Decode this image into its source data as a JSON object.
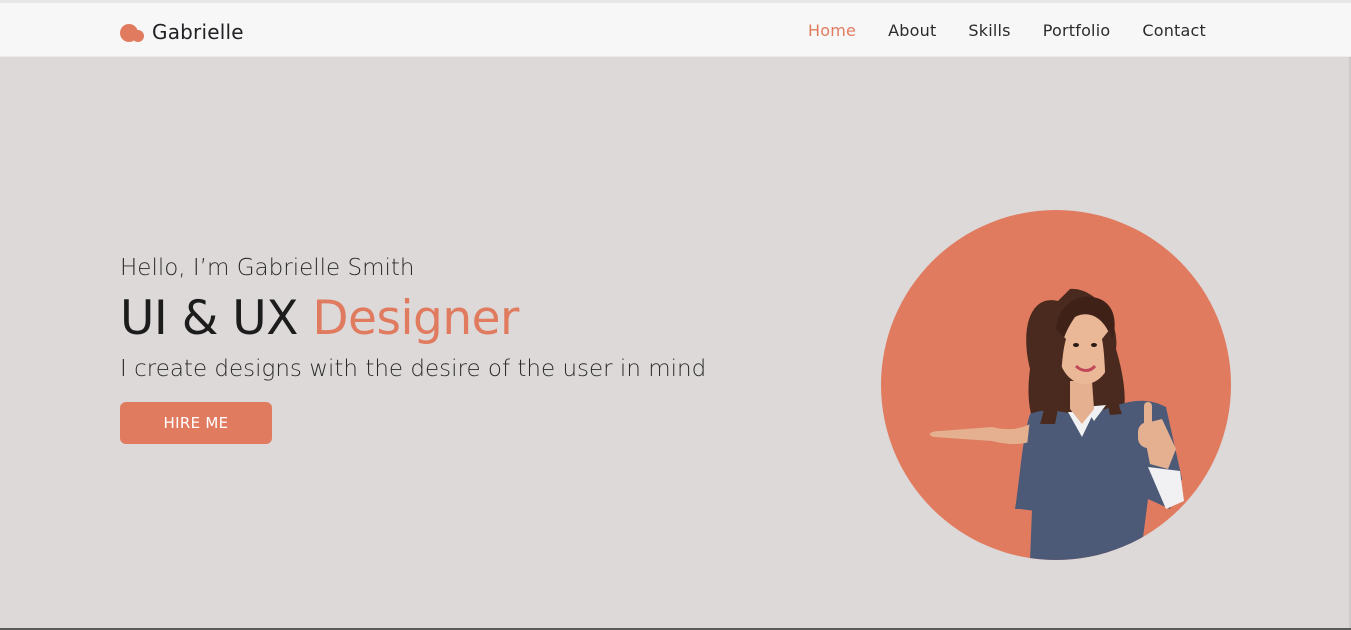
{
  "theme": {
    "accent": "#e07b5f",
    "background": "#ddd9d9",
    "navbar_bg": "#f7f7f7"
  },
  "brand": {
    "name": "Gabrielle",
    "icon": "logo-bubbles-icon"
  },
  "nav": {
    "items": [
      {
        "label": "Home",
        "active": true
      },
      {
        "label": "About",
        "active": false
      },
      {
        "label": "Skills",
        "active": false
      },
      {
        "label": "Portfolio",
        "active": false
      },
      {
        "label": "Contact",
        "active": false
      }
    ]
  },
  "hero": {
    "greeting": "Hello, I’m Gabrielle Smith",
    "title_main": "UI & UX",
    "title_accent": "Designer",
    "tagline": "I create designs with the desire of the user in mind",
    "cta_label": "HIRE ME",
    "image": "portrait-woman-thumbs-up"
  }
}
